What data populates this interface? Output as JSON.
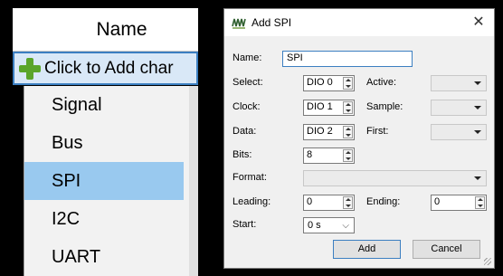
{
  "left_panel": {
    "header": "Name",
    "add_row_label": "Click to Add char",
    "menu_items": [
      "Signal",
      "Bus",
      "SPI",
      "I2C",
      "UART"
    ],
    "selected_item": "SPI"
  },
  "dialog": {
    "title": "Add SPI",
    "close_glyph": "✕",
    "name_label": "Name:",
    "name_value": "SPI",
    "select_label": "Select:",
    "select_value": "DIO 0",
    "active_label": "Active:",
    "clock_label": "Clock:",
    "clock_value": "DIO 1",
    "sample_label": "Sample:",
    "data_label": "Data:",
    "data_value": "DIO 2",
    "first_label": "First:",
    "bits_label": "Bits:",
    "bits_value": "8",
    "format_label": "Format:",
    "leading_label": "Leading:",
    "leading_value": "0",
    "ending_label": "Ending:",
    "ending_value": "0",
    "start_label": "Start:",
    "start_value": "0 s",
    "add_button": "Add",
    "cancel_button": "Cancel"
  },
  "colors": {
    "selection": "#99c9ef",
    "add_row_bg": "#d9e8f7",
    "accent": "#3c7fc1",
    "plus_green": "#5aa52a"
  }
}
